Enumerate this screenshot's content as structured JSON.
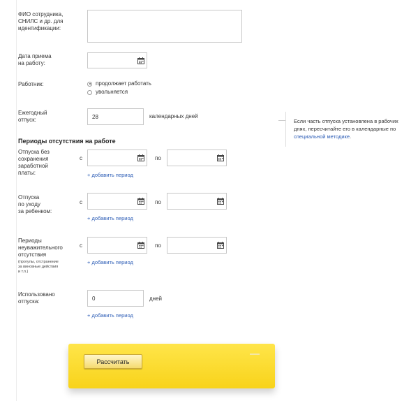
{
  "employee": {
    "label": "ФИО сотрудника,\nСНИЛС и др. для\nидентификации:",
    "value": ""
  },
  "hire_date": {
    "label": "Дата приема\nна работу:",
    "value": ""
  },
  "worker": {
    "label": "Работник:",
    "options": [
      "продолжает работать",
      "увольняется"
    ],
    "selected": "продолжает работать"
  },
  "annual_leave": {
    "label": "Ежегодный\nотпуск:",
    "value": "28",
    "unit": "календарных дней"
  },
  "note": {
    "text": "Если часть отпуска установлена в рабочих днях, пересчитайте его в календарные по ",
    "link": "специальной методике",
    "suffix": "."
  },
  "absence": {
    "title": "Периоды отсутствия на работе",
    "from_label": "с",
    "to_label": "по",
    "add_link": "+ добавить период",
    "rows": [
      {
        "label": "Отпуска без\nсохранения\nзаработной\nплаты:",
        "from": "",
        "to": ""
      },
      {
        "label": "Отпуска\nпо уходу\nза ребенком:",
        "from": "",
        "to": ""
      },
      {
        "label": "Периоды\nнеуважительного\nотсутствия",
        "note": "(прогулы, отстранение\nза виновные действия\nи т.п.)",
        "from": "",
        "to": ""
      }
    ]
  },
  "used_leave": {
    "label": "Использовано\nотпуска:",
    "value": "0",
    "unit": "дней",
    "add_link": "+ добавить период"
  },
  "calculate": {
    "label": "Рассчитать"
  },
  "icons": {
    "calendar": "calendar-icon",
    "radio": "radio-icon"
  }
}
